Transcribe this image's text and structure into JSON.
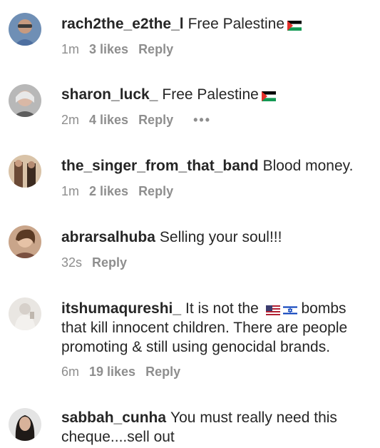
{
  "comments": [
    {
      "username": "rach2the_e2the_l",
      "text": "Free Palestine",
      "flag": "palestine",
      "time": "1m",
      "likes": "3 likes",
      "reply": "Reply",
      "more": ""
    },
    {
      "username": "sharon_luck_",
      "text": "Free Palestine",
      "flag": "palestine",
      "time": "2m",
      "likes": "4 likes",
      "reply": "Reply",
      "more": "•••"
    },
    {
      "username": "the_singer_from_that_band",
      "text": "Blood money.",
      "flag": "",
      "time": "1m",
      "likes": "2 likes",
      "reply": "Reply",
      "more": ""
    },
    {
      "username": "abrarsalhuba",
      "text": "Selling your soul!!!",
      "flag": "",
      "time": "32s",
      "likes": "",
      "reply": "Reply",
      "more": ""
    },
    {
      "username": "itshumaqureshi_",
      "text_before": "It is not the",
      "text": "bombs that kill innocent children. There are people promoting & still using genocidal brands.",
      "flags": [
        "usa",
        "israel"
      ],
      "time": "6m",
      "likes": "19 likes",
      "reply": "Reply",
      "more": ""
    },
    {
      "username": "sabbah_cunha",
      "text": "You must really need this cheque....sell out",
      "flag": "",
      "time": "",
      "likes": "",
      "reply": "",
      "more": ""
    }
  ],
  "colors": {
    "text": "#262626",
    "meta": "#8e8e8e"
  }
}
